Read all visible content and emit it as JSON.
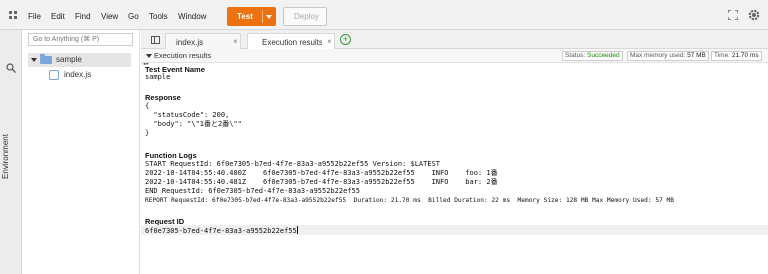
{
  "menu": {
    "items": [
      "File",
      "Edit",
      "Find",
      "View",
      "Go",
      "Tools",
      "Window"
    ],
    "test_label": "Test",
    "deploy_label": "Deploy"
  },
  "sidebar": {
    "env_label": "Environment"
  },
  "tree": {
    "goto_placeholder": "Go to Anything (⌘ P)",
    "folder_name": "sample",
    "file_name": "index.js"
  },
  "tabs": [
    {
      "label": "index.js",
      "close": "×"
    },
    {
      "label": "Execution results",
      "close": "×"
    }
  ],
  "results": {
    "header": "Execution results",
    "status_label": "Status:",
    "status_value": "Succeeded",
    "memory_label": "Max memory used:",
    "memory_value": "57 MB",
    "time_label": "Time:",
    "time_value": "21.70 ms",
    "test_event_title": "Test Event Name",
    "test_event_value": "sample",
    "response_title": "Response",
    "response_lines": [
      "{",
      "  \"statusCode\": 200,",
      "  \"body\": \"\\\"1番と2番\\\"\"",
      "}"
    ],
    "logs_title": "Function Logs",
    "log_lines": [
      "START RequestId: 6f0e7305-b7ed-4f7e-83a3-a9552b22ef55 Version: $LATEST",
      "2022-10-14T04:55:40.480Z    6f0e7305-b7ed-4f7e-83a3-a9552b22ef55    INFO    foo: 1番",
      "2022-10-14T04:55:40.481Z    6f0e7305-b7ed-4f7e-83a3-a9552b22ef55    INFO    bar: 2番",
      "END RequestId: 6f0e7305-b7ed-4f7e-83a3-a9552b22ef55",
      "REPORT RequestId: 6f0e7305-b7ed-4f7e-83a3-a9552b22ef55  Duration: 21.70 ms  Billed Duration: 22 ms  Memory Size: 128 MB Max Memory Used: 57 MB"
    ],
    "request_id_title": "Request ID",
    "request_id_value": "6f0e7305-b7ed-4f7e-83a3-a9552b22ef55"
  },
  "colors": {
    "accent": "#ec7211",
    "success": "#1d8102",
    "folder": "#7aa7d8"
  },
  "icons": [
    "grid-logo-icon",
    "fullscreen-icon",
    "gear-icon",
    "search-icon",
    "folder-icon",
    "file-icon",
    "panel-icon",
    "add-icon"
  ]
}
